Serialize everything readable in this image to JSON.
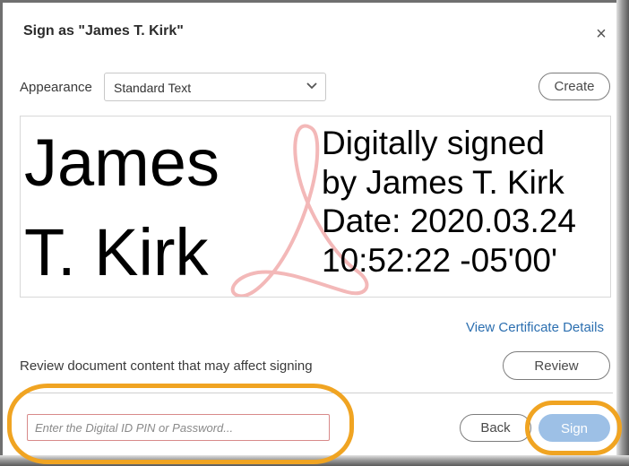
{
  "dialog": {
    "title": "Sign as \"James T. Kirk\"",
    "close_symbol": "×"
  },
  "appearance": {
    "label": "Appearance",
    "selected": "Standard Text",
    "create_label": "Create"
  },
  "signature_preview": {
    "name_line1": "James",
    "name_line2": "T. Kirk",
    "details": [
      "Digitally signed",
      "by James T. Kirk",
      "Date: 2020.03.24",
      "10:52:22 -05'00'"
    ],
    "watermark_icon": "acrobat-logo-icon"
  },
  "certificate_link": "View Certificate Details",
  "review": {
    "text": "Review document content that may affect signing",
    "button_label": "Review"
  },
  "footer": {
    "pin_placeholder": "Enter the Digital ID PIN or Password...",
    "pin_value": "",
    "back_label": "Back",
    "sign_label": "Sign"
  },
  "colors": {
    "link": "#2c6fb0",
    "sign_button": "#9dc0e6",
    "highlight": "#f0a422",
    "watermark": "#f3b8b8"
  }
}
